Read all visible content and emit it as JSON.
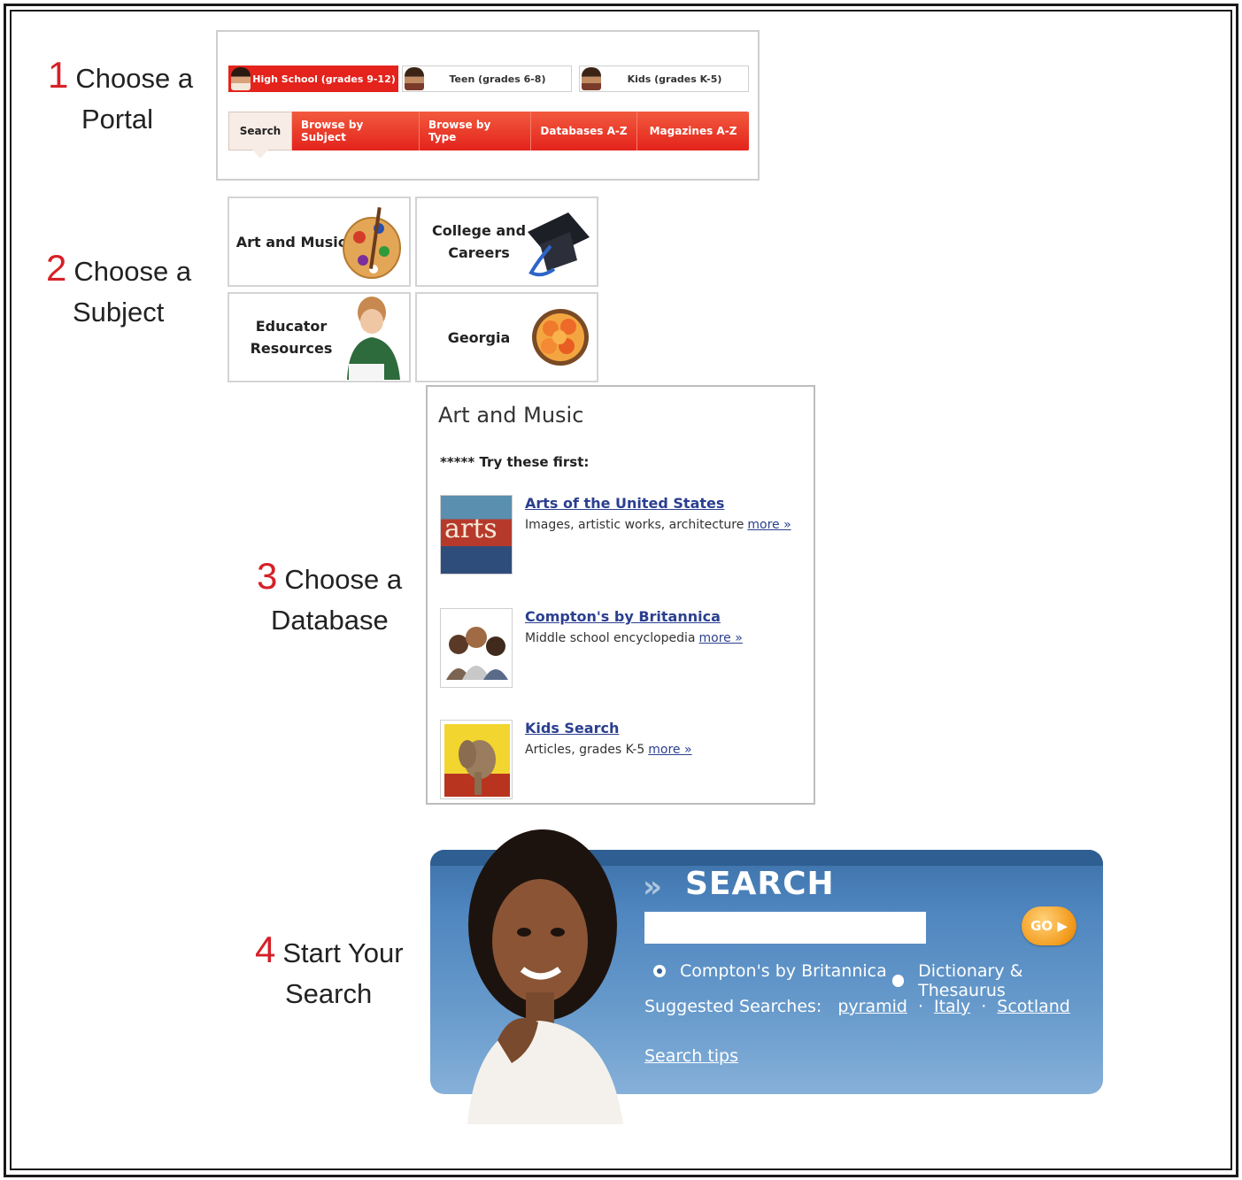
{
  "steps": [
    {
      "num": "1",
      "line1": "Choose a",
      "line2": "Portal"
    },
    {
      "num": "2",
      "line1": "Choose a",
      "line2": "Subject"
    },
    {
      "num": "3",
      "line1": "Choose a",
      "line2": "Database"
    },
    {
      "num": "4",
      "line1": "Start Your",
      "line2": "Search"
    }
  ],
  "portal": {
    "tabs": [
      "High School (grades 9-12)",
      "Teen (grades 6-8)",
      "Kids (grades K-5)"
    ],
    "active_tab": "High School (grades 9-12)",
    "nav": [
      "Search",
      "Browse by Subject",
      "Browse by Type",
      "Databases A-Z",
      "Magazines A-Z"
    ],
    "active_nav": "Search"
  },
  "subjects": [
    {
      "label_1": "Art and Music",
      "label_2": "",
      "icon": "palette-icon"
    },
    {
      "label_1": "College and",
      "label_2": "Careers",
      "icon": "graduation-cap-icon"
    },
    {
      "label_1": "Educator",
      "label_2": "Resources",
      "icon": "student-writing-icon"
    },
    {
      "label_1": "Georgia",
      "label_2": "",
      "icon": "peaches-icon"
    }
  ],
  "database": {
    "title": "Art and Music",
    "stars": "*****",
    "try_first": "Try these first:",
    "items": [
      {
        "name": "Arts of the United States",
        "desc": "Images, artistic works, architecture",
        "more": "more »",
        "thumb_text": "arts"
      },
      {
        "name": "Compton's by Britannica",
        "desc": "Middle school encyclopedia",
        "more": "more »"
      },
      {
        "name": "Kids Search",
        "desc": "Articles, grades K-5",
        "more": "more »"
      }
    ]
  },
  "search": {
    "title": "SEARCH",
    "input_value": "",
    "go_label": "GO",
    "radio_options": [
      "Compton's by Britannica",
      "Dictionary & Thesaurus"
    ],
    "selected_radio": "Compton's by Britannica",
    "suggested_label": "Suggested Searches:",
    "suggested": [
      "pyramid",
      "Italy",
      "Scotland"
    ],
    "tips": "Search tips"
  },
  "colors": {
    "accent_red": "#e3231c",
    "step_number_red": "#d62027",
    "link_blue": "#2b3f8f",
    "search_blue": "#4f86bf",
    "go_orange": "#f39a1b"
  }
}
